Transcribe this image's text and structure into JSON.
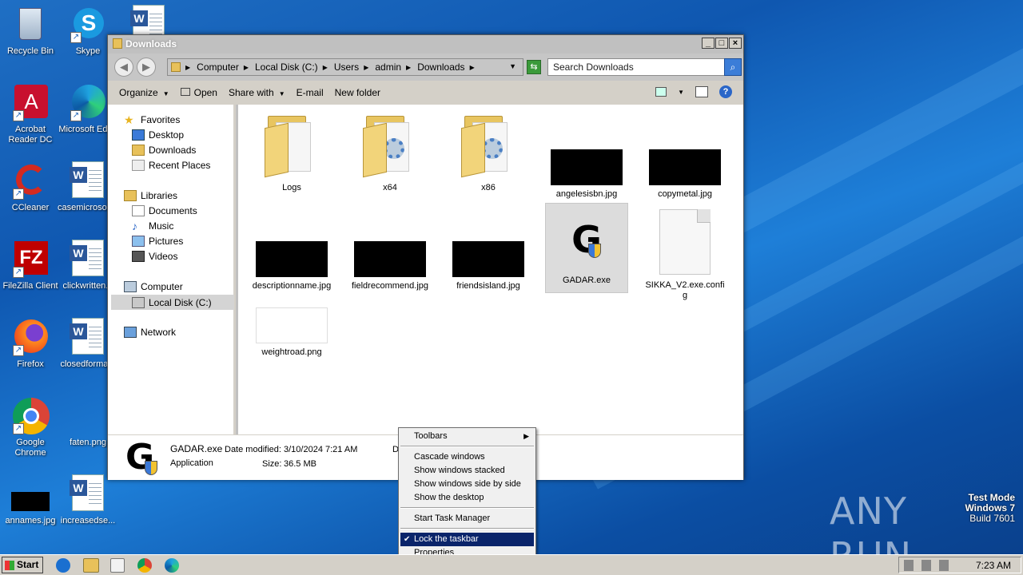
{
  "desktop": {
    "icons": [
      {
        "label": "Recycle Bin",
        "icon": "recycle-bin-icon"
      },
      {
        "label": "Skype",
        "icon": "skype-icon"
      },
      {
        "label": "Acrobat Reader DC",
        "icon": "acrobat-icon"
      },
      {
        "label": "Microsoft Edge",
        "icon": "edge-icon"
      },
      {
        "label": "CCleaner",
        "icon": "ccleaner-icon"
      },
      {
        "label": "casemicrosoft...",
        "icon": "word-doc-icon"
      },
      {
        "label": "FileZilla Client",
        "icon": "filezilla-icon"
      },
      {
        "label": "clickwritten...",
        "icon": "word-doc-icon"
      },
      {
        "label": "Firefox",
        "icon": "firefox-icon"
      },
      {
        "label": "closedforma...",
        "icon": "word-doc-icon"
      },
      {
        "label": "Google Chrome",
        "icon": "chrome-icon"
      },
      {
        "label": "faten.png",
        "icon": "image-icon"
      },
      {
        "label": "annames.jpg",
        "icon": "image-icon"
      },
      {
        "label": "increasedse...",
        "icon": "word-doc-icon"
      }
    ]
  },
  "explorer": {
    "title": "Downloads",
    "breadcrumb": [
      "Computer",
      "Local Disk (C:)",
      "Users",
      "admin",
      "Downloads"
    ],
    "search_placeholder": "Search Downloads",
    "toolbar": {
      "organize": "Organize",
      "open": "Open",
      "share_with": "Share with",
      "email": "E-mail",
      "new_folder": "New folder"
    },
    "nav": {
      "favorites": "Favorites",
      "desktop": "Desktop",
      "downloads": "Downloads",
      "recent_places": "Recent Places",
      "libraries": "Libraries",
      "documents": "Documents",
      "music": "Music",
      "pictures": "Pictures",
      "videos": "Videos",
      "computer": "Computer",
      "local_disk": "Local Disk (C:)",
      "network": "Network"
    },
    "files": [
      {
        "name": "Logs",
        "type": "folder"
      },
      {
        "name": "x64",
        "type": "folder-gear"
      },
      {
        "name": "x86",
        "type": "folder-gear"
      },
      {
        "name": "angelesisbn.jpg",
        "type": "image"
      },
      {
        "name": "copymetal.jpg",
        "type": "image"
      },
      {
        "name": "descriptionname.jpg",
        "type": "image"
      },
      {
        "name": "fieldrecommend.jpg",
        "type": "image"
      },
      {
        "name": "friendsisland.jpg",
        "type": "image"
      },
      {
        "name": "GADAR.exe",
        "type": "exe"
      },
      {
        "name": "SIKKA_V2.exe.config",
        "type": "doc"
      },
      {
        "name": "weightroad.png",
        "type": "image-white"
      }
    ],
    "details": {
      "name": "GADAR.exe",
      "type": "Application",
      "modified_label": "Date modified:",
      "modified_value": "3/10/2024 7:21 AM",
      "size_label": "Size:",
      "size_value": "36.5 MB",
      "extra": "D"
    }
  },
  "context_menu": {
    "toolbars": "Toolbars",
    "cascade": "Cascade windows",
    "stacked": "Show windows stacked",
    "side_by_side": "Show windows side by side",
    "show_desktop": "Show the desktop",
    "task_manager": "Start Task Manager",
    "lock_taskbar": "Lock the taskbar",
    "properties": "Properties"
  },
  "taskbar": {
    "start": "Start",
    "clock": "7:23 AM"
  },
  "watermark": {
    "mode": "Test Mode",
    "os": "Windows 7",
    "build": "Build 7601",
    "brand": "ANY RUN"
  }
}
